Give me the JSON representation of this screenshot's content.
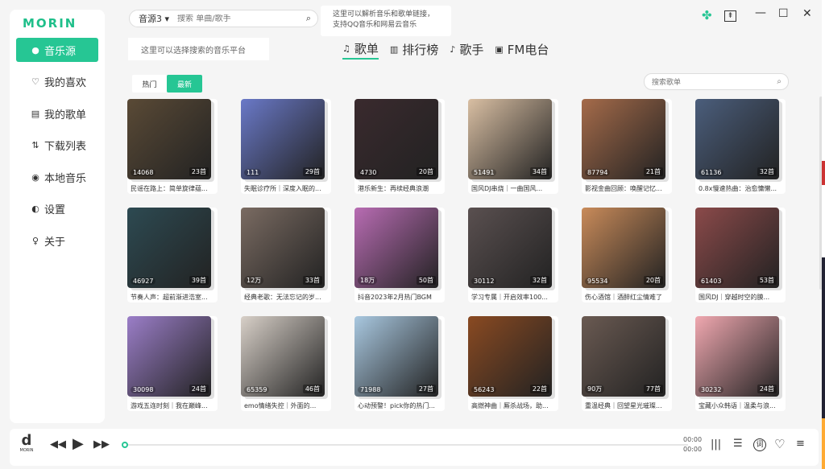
{
  "app": {
    "logo": "MORIN"
  },
  "sidebar": {
    "items": [
      {
        "label": "音乐源",
        "icon": "music-source-icon"
      },
      {
        "label": "我的喜欢",
        "icon": "heart-icon"
      },
      {
        "label": "我的歌单",
        "icon": "playlist-icon"
      },
      {
        "label": "下载列表",
        "icon": "download-icon"
      },
      {
        "label": "本地音乐",
        "icon": "local-music-icon"
      },
      {
        "label": "设置",
        "icon": "settings-icon"
      },
      {
        "label": "关于",
        "icon": "about-icon"
      }
    ]
  },
  "search": {
    "source": "音源3",
    "placeholder": "搜索 单曲/歌手"
  },
  "tips": {
    "parse_link": "这里可以解析音乐和歌单链接，支持QQ音乐和网易云音乐",
    "platform": "这里可以选择搜索的音乐平台"
  },
  "tabs": [
    "歌单",
    "排行榜",
    "歌手",
    "FM电台"
  ],
  "filters": {
    "hot": "热门",
    "latest": "最新"
  },
  "playlist_search": {
    "placeholder": "搜索歌单"
  },
  "playlists": [
    {
      "plays": "14068",
      "count": "23首",
      "title": "民谣在路上：简单旋律蕴...",
      "color": "#5a4a36"
    },
    {
      "plays": "111",
      "count": "29首",
      "title": "失眠诊疗所｜深度入眠的...",
      "color": "#6a79c8"
    },
    {
      "plays": "4730",
      "count": "20首",
      "title": "港乐新生：再续经典浪潮",
      "color": "#3a2a2e"
    },
    {
      "plays": "51491",
      "count": "34首",
      "title": "国风DJ串烧｜一曲国风...",
      "color": "#d9bfa3"
    },
    {
      "plays": "87794",
      "count": "21首",
      "title": "影视金曲回顾：唤醒记忆...",
      "color": "#a56b4a"
    },
    {
      "plays": "61136",
      "count": "32首",
      "title": "0.8x慢速热曲：治愈慵懒...",
      "color": "#4b5e7c"
    },
    {
      "plays": "46927",
      "count": "39首",
      "title": "节奏人声：超前渐进浩室...",
      "color": "#2d4a52"
    },
    {
      "plays": "12万",
      "count": "33首",
      "title": "经典老歌：无法忘记的岁...",
      "color": "#7a6b62"
    },
    {
      "plays": "18万",
      "count": "50首",
      "title": "抖音2023年2月热门BGM",
      "color": "#b86cb3"
    },
    {
      "plays": "30112",
      "count": "32首",
      "title": "学习专属｜开启效率100...",
      "color": "#5a5050"
    },
    {
      "plays": "95534",
      "count": "20首",
      "title": "伤心酒馆｜酒醉红尘情难了",
      "color": "#c98b5a"
    },
    {
      "plays": "61403",
      "count": "53首",
      "title": "国风DJ｜穿越时空的膜...",
      "color": "#8b4a4a"
    },
    {
      "plays": "30098",
      "count": "24首",
      "title": "游戏五连时刻｜我在巅峰...",
      "color": "#9b7ec8"
    },
    {
      "plays": "65359",
      "count": "46首",
      "title": "emo情绪失控｜外面的...",
      "color": "#d8d0c8"
    },
    {
      "plays": "71988",
      "count": "27首",
      "title": "心动预警！pick你的热门...",
      "color": "#a9c8e0"
    },
    {
      "plays": "56243",
      "count": "22首",
      "title": "高燃神曲｜厮杀战场，助...",
      "color": "#8a4a22"
    },
    {
      "plays": "90万",
      "count": "77首",
      "title": "重温经典｜回望星光璀璨...",
      "color": "#6a5a52"
    },
    {
      "plays": "30232",
      "count": "24首",
      "title": "宝藏小众韩语｜温柔与浪...",
      "color": "#f0a8b0"
    }
  ],
  "player": {
    "logo_text": "MORIN",
    "time_current": "00:00",
    "time_total": "00:00",
    "lyric_label": "词"
  },
  "colors": {
    "accent": "#26c694",
    "bg": "#f5f5f5"
  }
}
